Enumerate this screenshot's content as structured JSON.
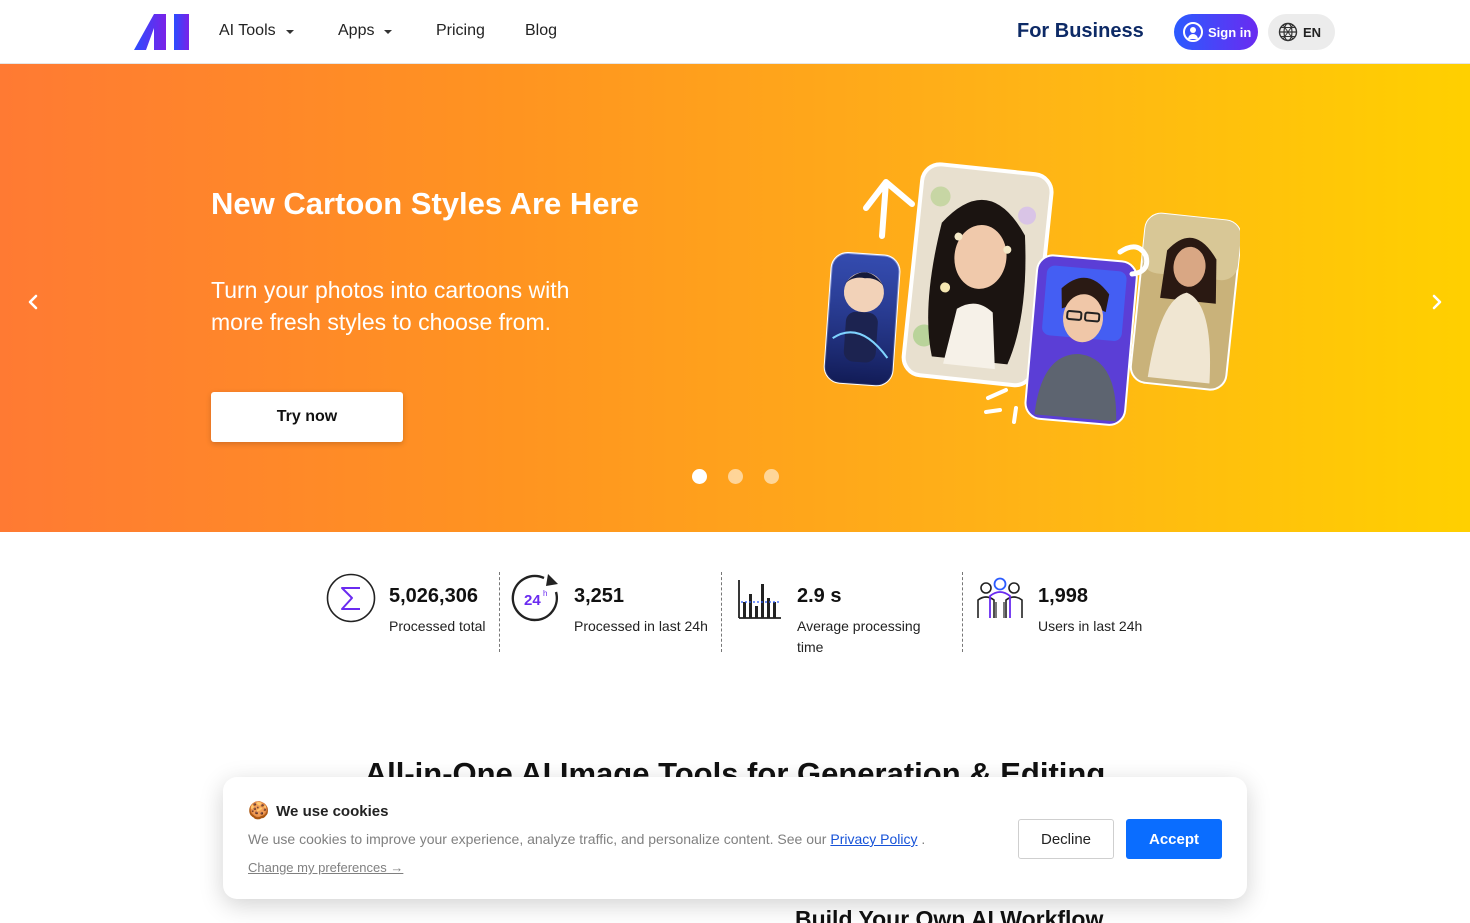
{
  "header": {
    "logo_text": "AI",
    "nav": [
      {
        "label": "AI Tools",
        "has_dropdown": true
      },
      {
        "label": "Apps",
        "has_dropdown": true
      },
      {
        "label": "Pricing",
        "has_dropdown": false
      },
      {
        "label": "Blog",
        "has_dropdown": false
      }
    ],
    "for_business": "For Business",
    "sign_in": "Sign in",
    "language": "EN"
  },
  "hero": {
    "title": "New Cartoon Styles Are Here",
    "subtitle": "Turn your photos into cartoons with more fresh styles to choose from.",
    "cta": "Try now",
    "slides_total": 3,
    "active_slide": 1
  },
  "stats": [
    {
      "value": "5,026,306",
      "label": "Processed total",
      "icon": "sigma-icon"
    },
    {
      "value": "3,251",
      "label": "Processed in last 24h",
      "icon": "clock-24h-icon"
    },
    {
      "value": "2.9 s",
      "label": "Average processing time",
      "icon": "bar-chart-icon"
    },
    {
      "value": "1,998",
      "label": "Users in last 24h",
      "icon": "users-group-icon"
    }
  ],
  "section": {
    "title": "All-in-One AI Image Tools for Generation & Editing",
    "workflow_title": "Build Your Own AI Workflow"
  },
  "cookie": {
    "emoji": "🍪",
    "title": "We use cookies",
    "text": "We use cookies to improve your experience, analyze traffic, and personalize content. See our",
    "policy_link": "Privacy Policy",
    "text_end": ".",
    "preferences": "Change my preferences →",
    "decline": "Decline",
    "accept": "Accept"
  },
  "colors": {
    "brand_blue": "#2b5bff",
    "brand_purple": "#6a2bf0",
    "accept_blue": "#0a6dff",
    "business_navy": "#0d2a66",
    "hero_start": "#ff7a33",
    "hero_end": "#ffd000"
  }
}
